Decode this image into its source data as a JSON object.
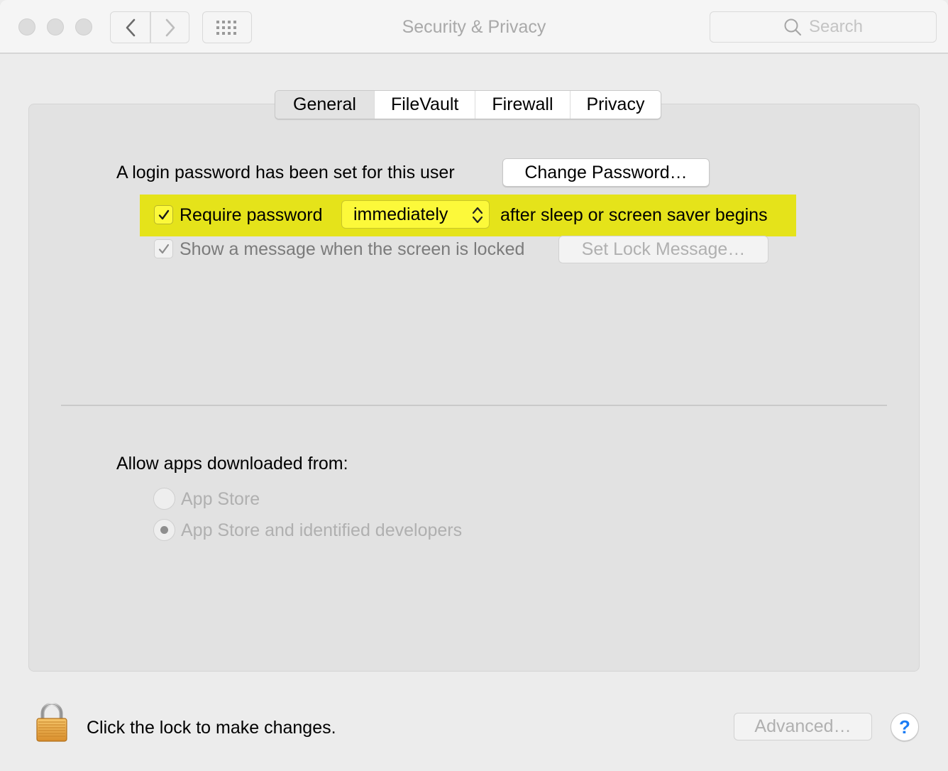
{
  "window": {
    "title": "Security & Privacy",
    "search": {
      "placeholder": "Search",
      "value": ""
    },
    "icons": {
      "back": "chevron-left-icon",
      "forward": "chevron-right-icon",
      "show_all": "grid-icon",
      "search": "magnifier-icon"
    }
  },
  "tabs": [
    {
      "label": "General",
      "selected": true
    },
    {
      "label": "FileVault",
      "selected": false
    },
    {
      "label": "Firewall",
      "selected": false
    },
    {
      "label": "Privacy",
      "selected": false
    }
  ],
  "general": {
    "login_password_text": "A login password has been set for this user",
    "change_password_button": "Change Password…",
    "require_password": {
      "label": "Require password",
      "checked": true,
      "delay_value": "immediately",
      "suffix": "after sleep or screen saver begins",
      "highlight_color": "#e5e31a"
    },
    "show_message": {
      "label": "Show a message when the screen is locked",
      "checked": true,
      "disabled": true,
      "button": "Set Lock Message…"
    },
    "allow_apps": {
      "label": "Allow apps downloaded from:",
      "options": [
        {
          "label": "App Store",
          "selected": false
        },
        {
          "label": "App Store and identified developers",
          "selected": true
        }
      ]
    }
  },
  "footer": {
    "lock_text": "Click the lock to make changes.",
    "advanced_button": "Advanced…",
    "help_label": "?",
    "help_color": "#1a7cf5"
  }
}
